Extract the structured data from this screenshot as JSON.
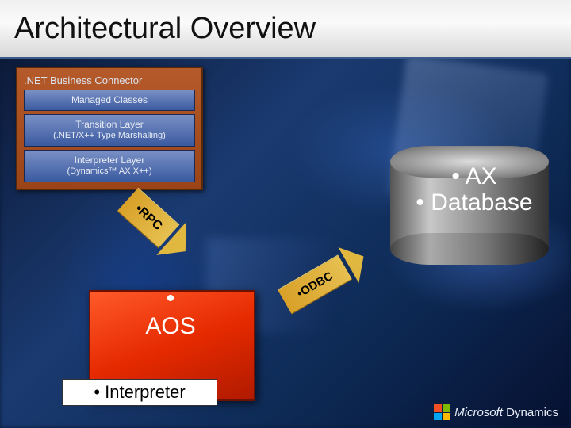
{
  "title": "Architectural Overview",
  "connector": {
    "header": ".NET Business Connector",
    "layers": [
      {
        "label": "Managed Classes",
        "sub": ""
      },
      {
        "label": "Transition Layer",
        "sub": "(.NET/X++ Type Marshalling)"
      },
      {
        "label": "Interpreter Layer",
        "sub": "(Dynamics™ AX X++)"
      }
    ]
  },
  "arrows": {
    "rpc": "•RPC",
    "odbc": "•ODBC"
  },
  "database": {
    "line1": "• AX",
    "line2": "• Database"
  },
  "aos": {
    "bullet": "•",
    "label": "AOS",
    "interpreter": "• Interpreter"
  },
  "footer": {
    "brand": "Microsoft",
    "product": "Dynamics"
  }
}
